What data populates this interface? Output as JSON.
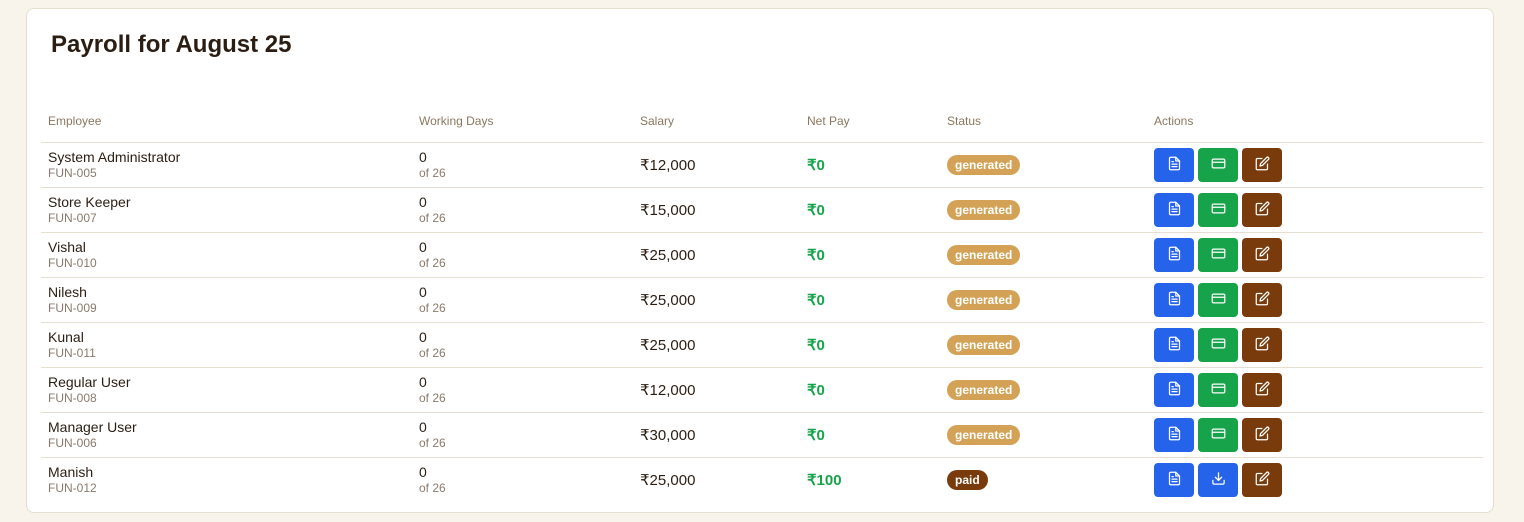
{
  "page_title": "Payroll for August 25",
  "columns": [
    "Employee",
    "Working Days",
    "Salary",
    "Net Pay",
    "Status",
    "Actions"
  ],
  "rows": [
    {
      "name": "System Administrator",
      "code": "FUN-005",
      "days": "0",
      "of": "of 26",
      "salary": "₹12,000",
      "net": "₹0",
      "status": "generated",
      "second_action": "card"
    },
    {
      "name": "Store Keeper",
      "code": "FUN-007",
      "days": "0",
      "of": "of 26",
      "salary": "₹15,000",
      "net": "₹0",
      "status": "generated",
      "second_action": "card"
    },
    {
      "name": "Vishal",
      "code": "FUN-010",
      "days": "0",
      "of": "of 26",
      "salary": "₹25,000",
      "net": "₹0",
      "status": "generated",
      "second_action": "card"
    },
    {
      "name": "Nilesh",
      "code": "FUN-009",
      "days": "0",
      "of": "of 26",
      "salary": "₹25,000",
      "net": "₹0",
      "status": "generated",
      "second_action": "card"
    },
    {
      "name": "Kunal",
      "code": "FUN-011",
      "days": "0",
      "of": "of 26",
      "salary": "₹25,000",
      "net": "₹0",
      "status": "generated",
      "second_action": "card"
    },
    {
      "name": "Regular User",
      "code": "FUN-008",
      "days": "0",
      "of": "of 26",
      "salary": "₹12,000",
      "net": "₹0",
      "status": "generated",
      "second_action": "card"
    },
    {
      "name": "Manager User",
      "code": "FUN-006",
      "days": "0",
      "of": "of 26",
      "salary": "₹30,000",
      "net": "₹0",
      "status": "generated",
      "second_action": "card"
    },
    {
      "name": "Manish",
      "code": "FUN-012",
      "days": "0",
      "of": "of 26",
      "salary": "₹25,000",
      "net": "₹100",
      "status": "paid",
      "second_action": "download"
    }
  ],
  "icons": {
    "view": "document-icon",
    "card": "credit-card-icon",
    "download": "download-icon",
    "edit": "edit-icon"
  },
  "colors": {
    "blue": "#2563eb",
    "green": "#16a34a",
    "brown": "#7a3b0c",
    "generated": "#d4a256",
    "net_pay": "#16a34a"
  }
}
